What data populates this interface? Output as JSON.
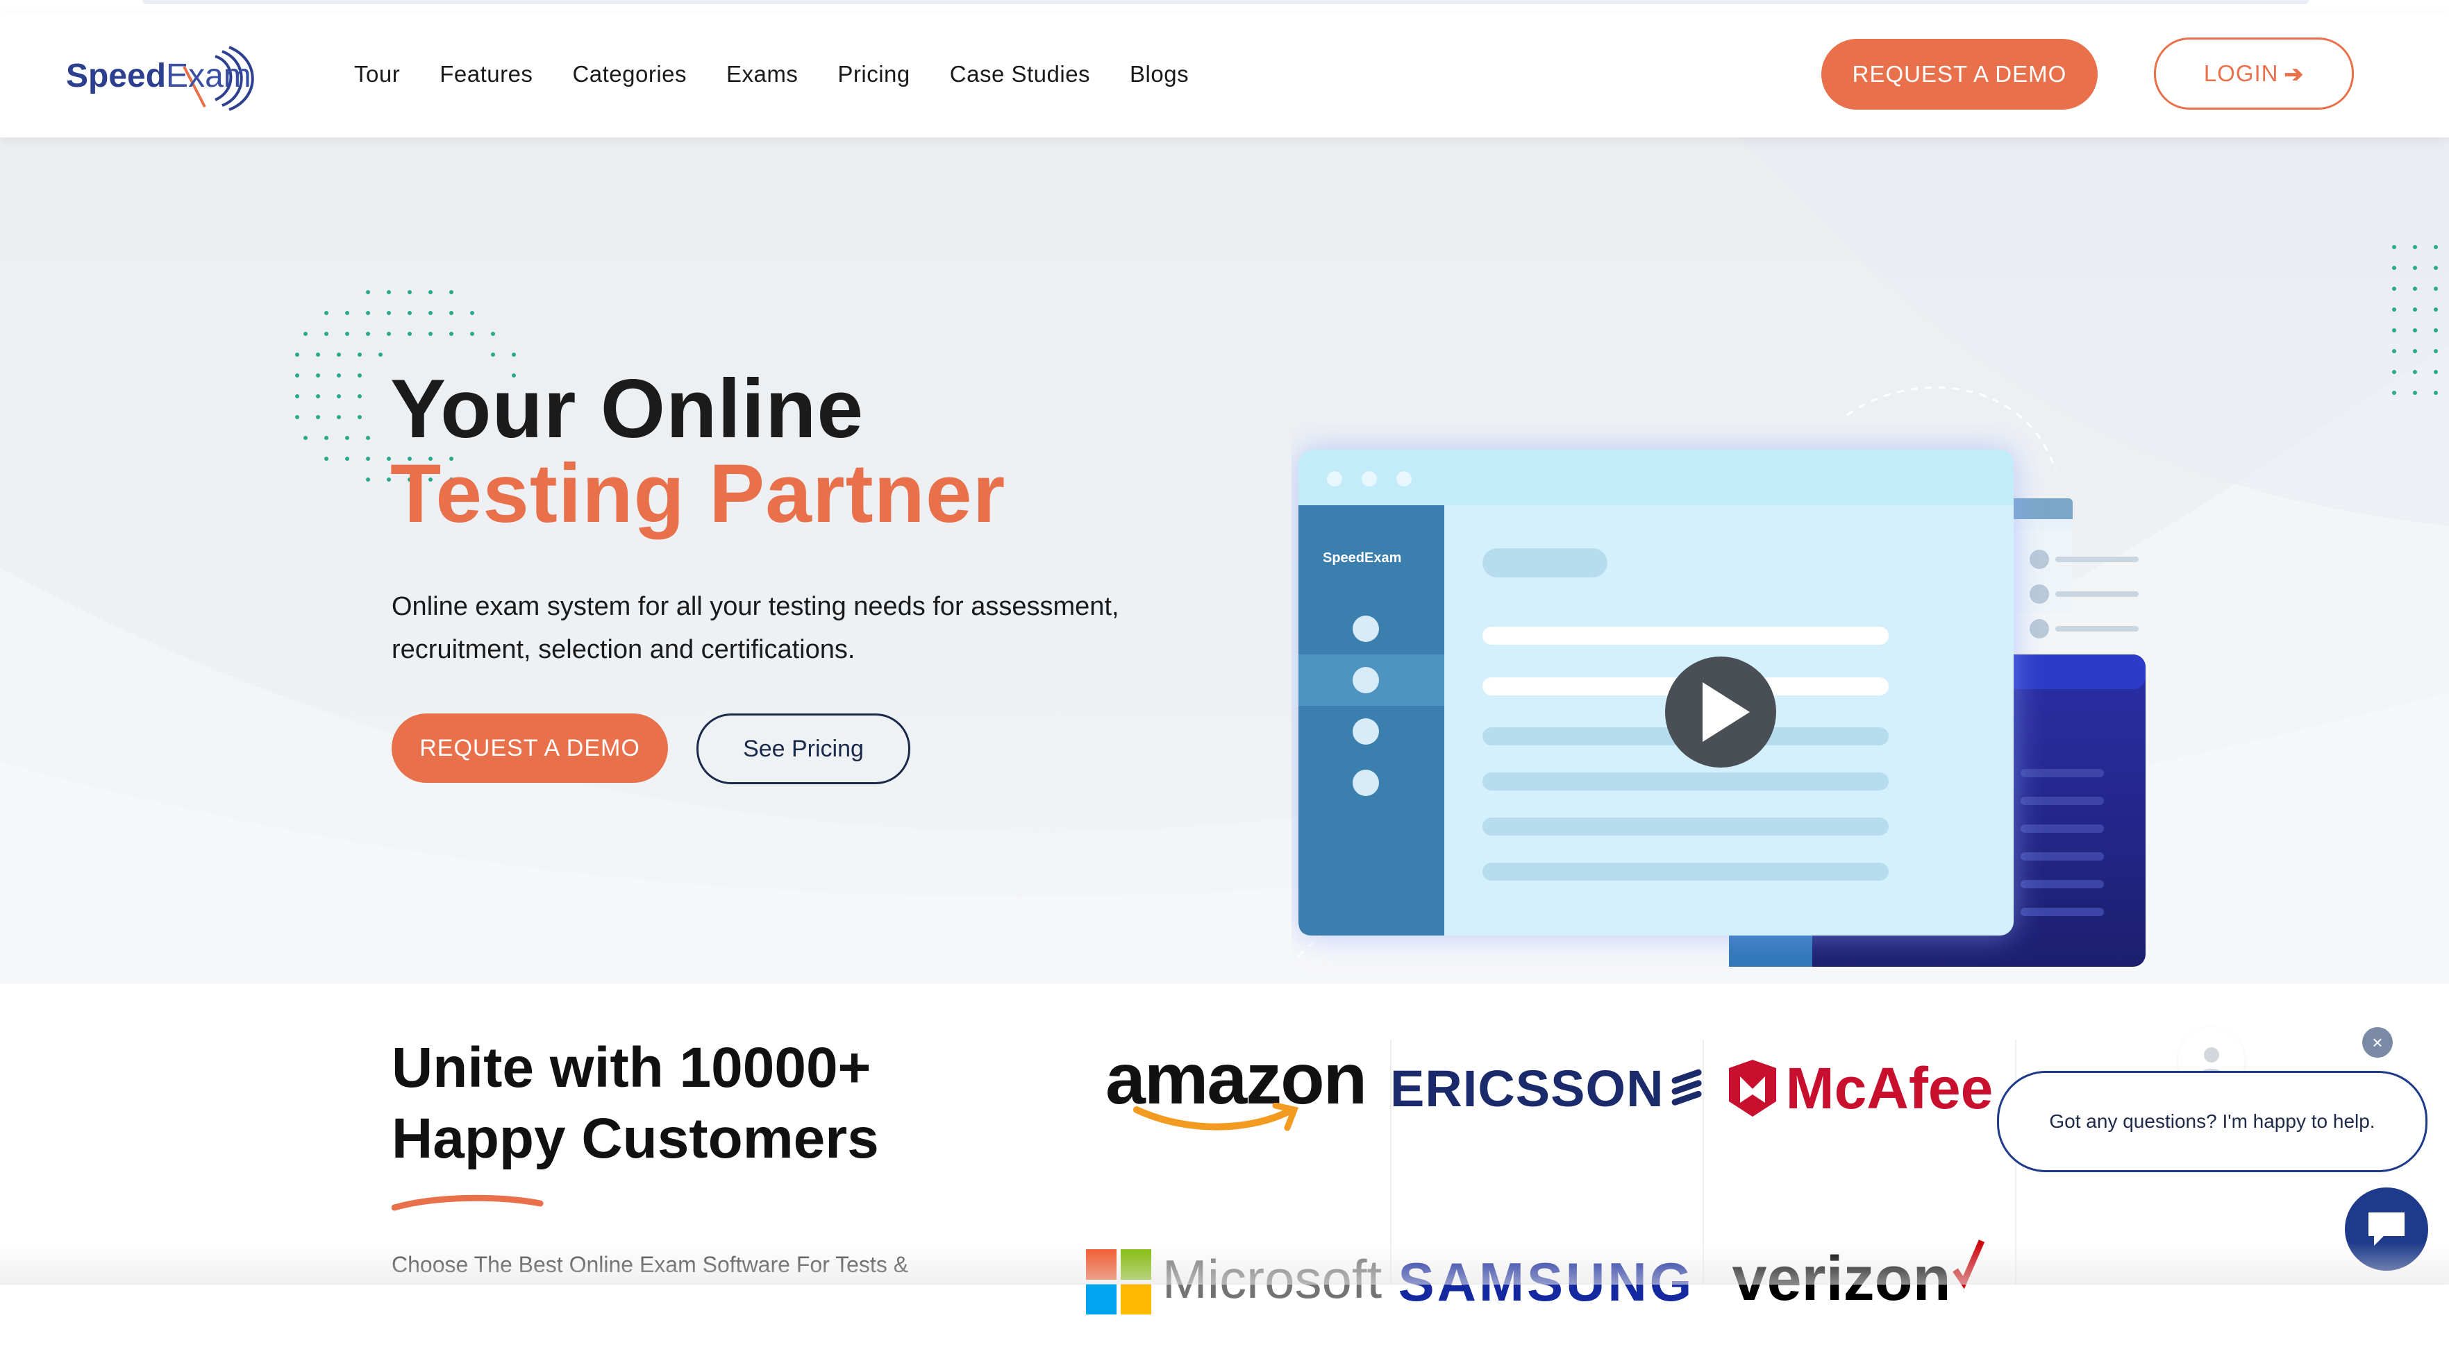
{
  "brand": {
    "logo_speed": "Speed",
    "logo_exam": "Exam"
  },
  "nav": {
    "items": [
      {
        "label": "Tour"
      },
      {
        "label": "Features"
      },
      {
        "label": "Categories"
      },
      {
        "label": "Exams"
      },
      {
        "label": "Pricing"
      },
      {
        "label": "Case Studies"
      },
      {
        "label": "Blogs"
      }
    ],
    "demo_button": "REQUEST A DEMO",
    "login_button": "LOGIN",
    "login_arrow": "➔"
  },
  "hero": {
    "title_line1": "Your Online",
    "title_line2": "Testing Partner",
    "description": "Online exam system for all your testing needs for assessment, recruitment, selection and certifications.",
    "cta_demo": "REQUEST A DEMO",
    "cta_pricing": "See Pricing",
    "mock_logo": "SpeedExam"
  },
  "customers": {
    "heading_line1": "Unite with 10000+",
    "heading_line2": "Happy Customers",
    "subtext": "Choose The Best Online Exam Software For Tests &",
    "logos": [
      "amazon",
      "ERICSSON",
      "McAfee",
      "Microsoft",
      "SAMSUNG",
      "verizon"
    ]
  },
  "chat": {
    "message": "Got any questions? I'm happy to help.",
    "close": "×"
  },
  "colors": {
    "accent": "#e8704a",
    "navy": "#1e3a8a",
    "brand_blue": "#2d3f8f"
  }
}
